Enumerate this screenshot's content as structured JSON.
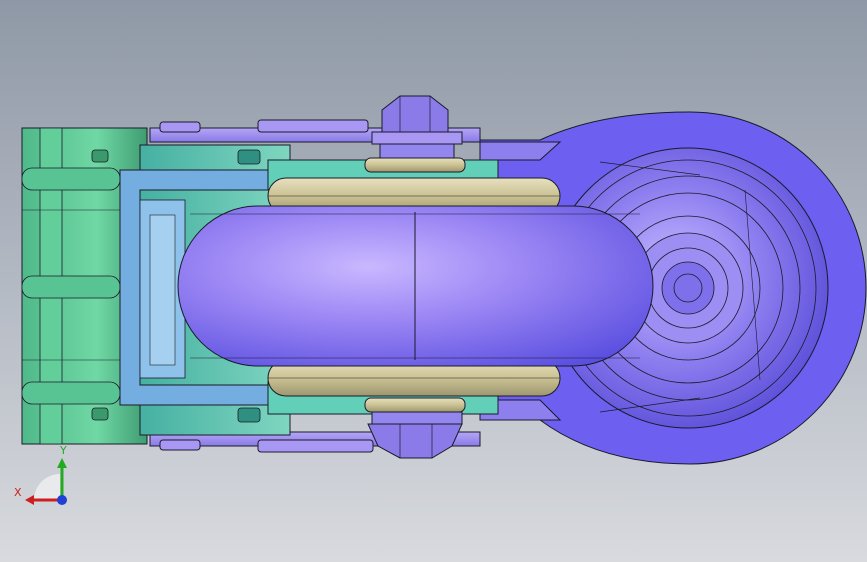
{
  "viewport": {
    "triad": {
      "x_label": "X",
      "y_label": "Y",
      "x_color": "#cc1f1f",
      "y_color": "#22aa22",
      "z_color": "#1f3fd6"
    }
  },
  "model": {
    "colors": {
      "frame_green": "#5ecb95",
      "frame_green_dark": "#3a9a6c",
      "bracket_blue": "#6aa6d6",
      "bracket_teal": "#53c2b0",
      "plate_violet": "#9f8ff0",
      "plate_violet_dark": "#6d5fd2",
      "wheel_violet": "#8f7ff2",
      "wheel_highlight": "#c7b6ff",
      "bearing_tan": "#cfc79a",
      "wire": "#1a1a2a"
    }
  }
}
